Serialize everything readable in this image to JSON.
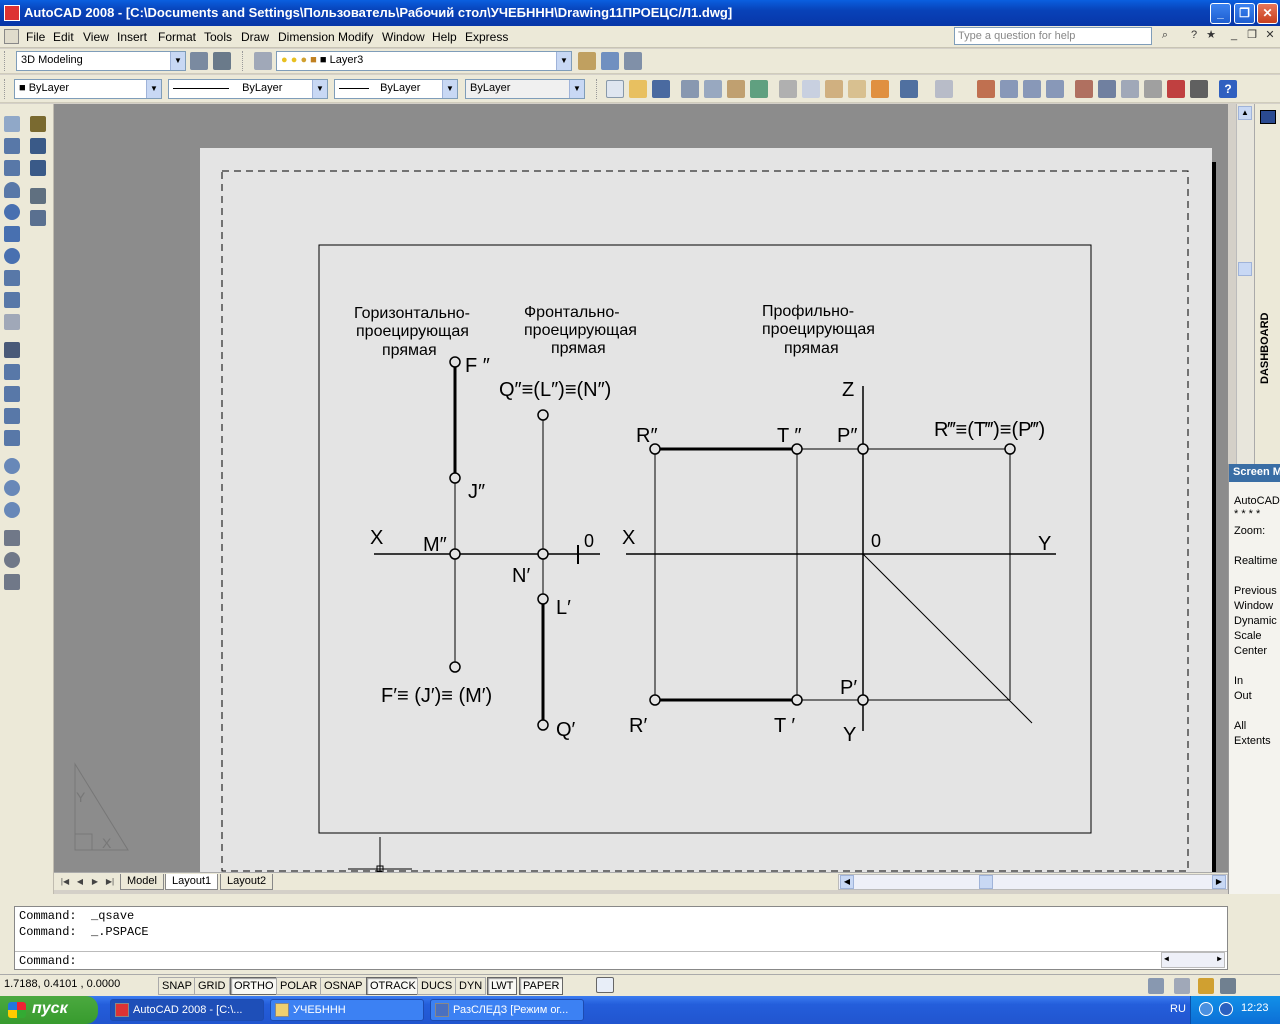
{
  "window": {
    "title": "AutoCAD 2008 - [C:\\Documents and Settings\\Пользователь\\Рабочий стол\\УЧЕБНHН\\Drawing11ПРОЕЦС/Л1.dwg]",
    "minimize": "_",
    "restore": "❐",
    "close": "✕"
  },
  "menu": {
    "items": [
      "File",
      "Edit",
      "View",
      "Insert",
      "Format",
      "Tools",
      "Draw",
      "Dimension",
      "Modify",
      "Window",
      "Help",
      "Express"
    ],
    "help_placeholder": "Type a question for help"
  },
  "toolbar1": {
    "workspace": "3D Modeling",
    "layer": "Layer3"
  },
  "toolbar2": {
    "color": "ByLayer",
    "linetype": "ByLayer",
    "lineweight": "ByLayer",
    "plotstyle": "ByLayer"
  },
  "drawing": {
    "label_horizontal": [
      "Горизонтально-",
      "проецирующая",
      "прямая"
    ],
    "label_frontal": [
      "Фронтально-",
      "проецирующая",
      "прямая"
    ],
    "label_profile": [
      "Профильно-",
      "проецирующая",
      "прямая"
    ],
    "F2": "F ″",
    "J2": "J″",
    "M2": "M″",
    "X": "X",
    "zero": "0",
    "N1": "N′",
    "L1": "L′",
    "Q1": "Q′",
    "QLN": "Q″≡(L″)≡(N″)",
    "FJM": "F′≡ (J′)≡ (M′)",
    "R2": "R″",
    "T2": "T ″",
    "P2": "P″",
    "RTP3": "R‴≡(T‴)≡(P‴)",
    "Z": "Z",
    "Y": "Y",
    "P1": "P′",
    "R1": "R′",
    "T1": "T ′"
  },
  "dashboard": {
    "label": "DASHBOARD"
  },
  "screen_menu": {
    "header": "Screen Menu",
    "items": [
      "AutoCAD",
      "* * * *",
      "Zoom:",
      "",
      "Realtime",
      "",
      "Previous",
      "Window",
      "Dynamic",
      "Scale",
      "Center",
      "",
      "In",
      "Out",
      "",
      "All",
      "Extents"
    ]
  },
  "tabs": [
    "Model",
    "Layout1",
    "Layout2"
  ],
  "active_tab": "Layout1",
  "command": {
    "line1": "Command:  _qsave",
    "line2": "Command:  _.PSPACE",
    "prompt": "Command:"
  },
  "status": {
    "coords": "1.7188, 0.4101 , 0.0000",
    "buttons": [
      "SNAP",
      "GRID",
      "ORTHO",
      "POLAR",
      "OSNAP",
      "OTRACK",
      "DUCS",
      "DYN",
      "LWT",
      "PAPER"
    ],
    "on": [
      "ORTHO",
      "OTRACK",
      "LWT",
      "PAPER"
    ]
  },
  "taskbar": {
    "start": "пуск",
    "tasks": [
      "AutoCAD 2008 - [C:\\...",
      "УЧЕБНHН",
      "РазСЛЕДЗ [Режим ог..."
    ],
    "lang": "RU",
    "clock": "12:23"
  }
}
